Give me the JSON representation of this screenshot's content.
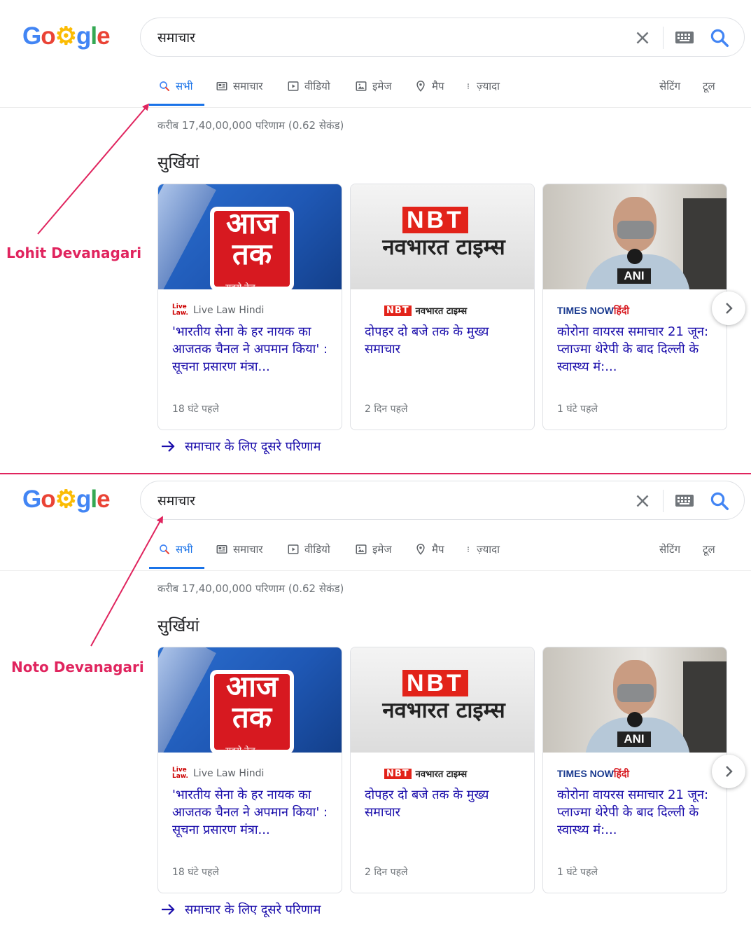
{
  "panels": [
    {
      "logo": [
        "G",
        "o",
        "o",
        "g",
        "l",
        "e"
      ],
      "search": {
        "value": "समाचार",
        "placeholder": ""
      },
      "tabs": [
        {
          "label": "सभी",
          "icon": "search-icon",
          "active": true
        },
        {
          "label": "समाचार",
          "icon": "news-icon"
        },
        {
          "label": "वीडियो",
          "icon": "video-icon"
        },
        {
          "label": "इमेज",
          "icon": "image-icon"
        },
        {
          "label": "मैप",
          "icon": "map-pin-icon"
        },
        {
          "label": "ज़्यादा",
          "icon": "more-vert-icon"
        }
      ],
      "settings_label": "सेटिंग",
      "tools_label": "टूल",
      "result_stats": "करीब 17,40,00,000 परिणाम (0.62 सेकंड)",
      "section_heading": "सुर्खियां",
      "cards": [
        {
          "thumbnail": {
            "logo_line1": "आज",
            "logo_line2": "तक",
            "caption": "सबसे तेज़"
          },
          "source": "Live Law Hindi",
          "source_logo": "Live Law.",
          "headline": "'भारतीय सेना के हर नायक का आजतक चैनल ने अपमान किया' : सूचना प्रसारण मंत्रा...",
          "age": "18 घंटे पहले"
        },
        {
          "thumbnail": {
            "logo_line1": "NBT",
            "logo_line2": "नवभारत टाइम्स"
          },
          "source_logo": "NBT",
          "source": "नवभारत टाइम्स",
          "headline": "दोपहर दो बजे तक के मुख्य समाचार",
          "age": "2 दिन पहले"
        },
        {
          "thumbnail": {
            "mic_label": "ANI"
          },
          "source_logo": "TIMES NOW",
          "source": "हिंदी",
          "headline": "कोरोना वायरस समाचार 21 जून: प्लाज्मा थेरेपी के बाद दिल्ली के स्वास्थ्य मं:...",
          "age": "1 घंटे पहले"
        }
      ],
      "more_results": "समाचार के लिए दूसरे परिणाम"
    },
    {
      "logo": [
        "G",
        "o",
        "o",
        "g",
        "l",
        "e"
      ],
      "search": {
        "value": "समाचार",
        "placeholder": ""
      },
      "tabs": [
        {
          "label": "सभी",
          "icon": "search-icon",
          "active": true
        },
        {
          "label": "समाचार",
          "icon": "news-icon"
        },
        {
          "label": "वीडियो",
          "icon": "video-icon"
        },
        {
          "label": "इमेज",
          "icon": "image-icon"
        },
        {
          "label": "मैप",
          "icon": "map-pin-icon"
        },
        {
          "label": "ज़्यादा",
          "icon": "more-vert-icon"
        }
      ],
      "settings_label": "सेटिंग",
      "tools_label": "टूल",
      "result_stats": "करीब 17,40,00,000 परिणाम (0.62 सेकंड)",
      "section_heading": "सुर्खियां",
      "cards": [
        {
          "thumbnail": {
            "logo_line1": "आज",
            "logo_line2": "तक",
            "caption": "सबसे तेज़"
          },
          "source": "Live Law Hindi",
          "source_logo": "Live Law.",
          "headline": "'भारतीय सेना के हर नायक का आजतक चैनल ने अपमान किया' : सूचना प्रसारण मंत्रा...",
          "age": "18 घंटे पहले"
        },
        {
          "thumbnail": {
            "logo_line1": "NBT",
            "logo_line2": "नवभारत टाइम्स"
          },
          "source_logo": "NBT",
          "source": "नवभारत टाइम्स",
          "headline": "दोपहर दो बजे तक के मुख्य समाचार",
          "age": "2 दिन पहले"
        },
        {
          "thumbnail": {
            "mic_label": "ANI"
          },
          "source_logo": "TIMES NOW",
          "source": "हिंदी",
          "headline": "कोरोना वायरस समाचार 21 जून: प्लाज्मा थेरेपी के बाद दिल्ली के स्वास्थ्य मं:...",
          "age": "1 घंटे पहले"
        }
      ],
      "more_results": "समाचार के लिए दूसरे परिणाम"
    }
  ],
  "annotations": [
    {
      "label": "Lohit Devanagari"
    },
    {
      "label": "Noto Devanagari"
    }
  ],
  "colors": {
    "annotation": "#e0245e",
    "link": "#1a0dab",
    "accent": "#1a73e8",
    "aajtak_red": "#d71920",
    "nbt_red": "#e2231a",
    "timesnow_blue": "#1a3a8f"
  }
}
